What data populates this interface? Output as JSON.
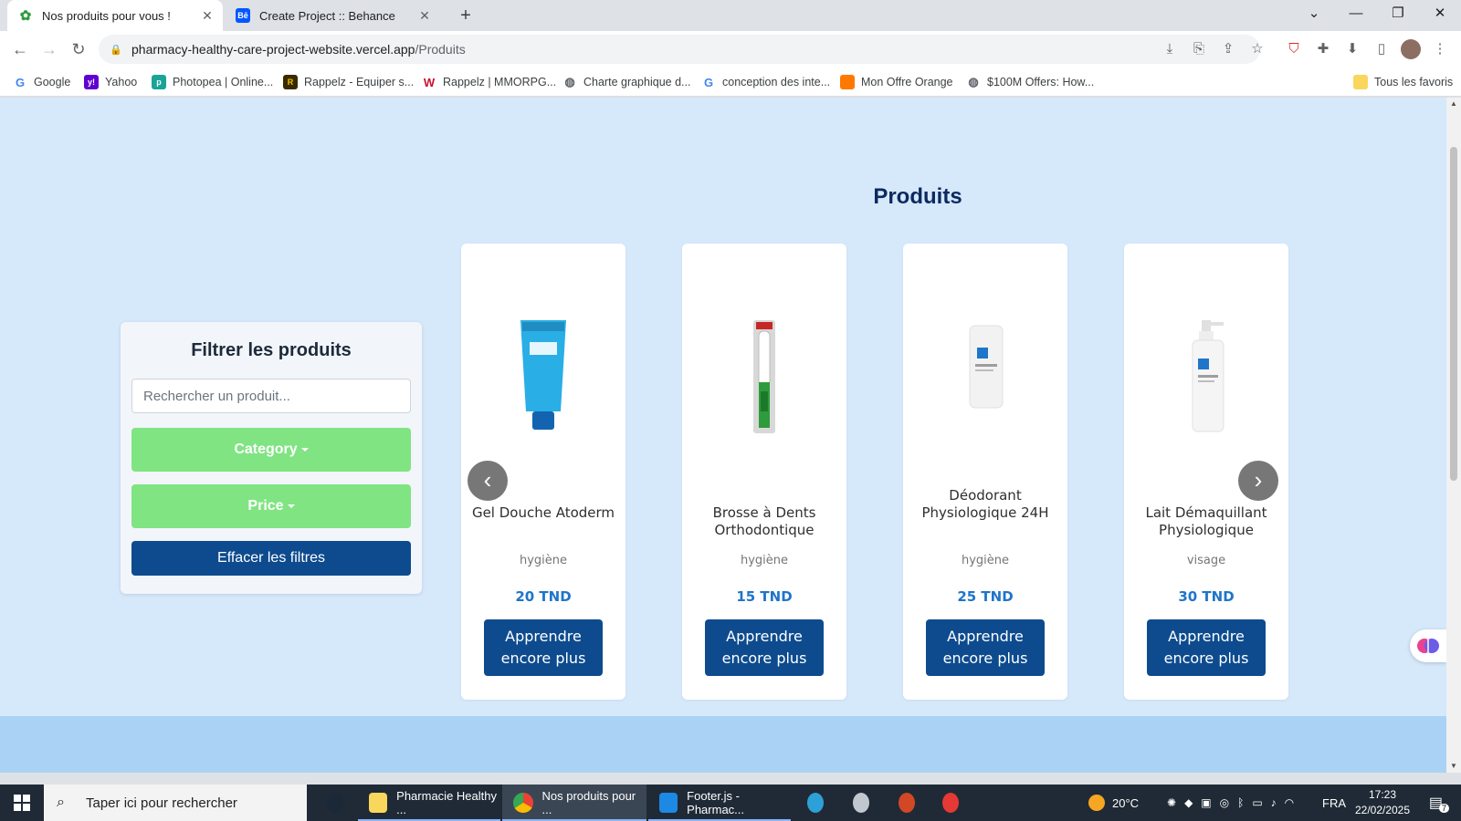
{
  "browser": {
    "tabs": [
      {
        "title": "Nos produits pour vous !",
        "active": true
      },
      {
        "title": "Create Project :: Behance",
        "active": false
      }
    ],
    "url_host": "pharmacy-healthy-care-project-website.vercel.app",
    "url_path": "/Produits",
    "bookmarks": [
      {
        "label": "Google",
        "icon": "google-icon",
        "color": "#4285f4"
      },
      {
        "label": "Yahoo",
        "icon": "yahoo-icon",
        "color": "#6001d2"
      },
      {
        "label": "Photopea | Online...",
        "icon": "photopea-icon",
        "color": "#18a497"
      },
      {
        "label": "Rappelz - Equiper s...",
        "icon": "rappelz-icon",
        "color": "#3a2a00"
      },
      {
        "label": "Rappelz | MMORPG...",
        "icon": "rappelz-w-icon",
        "color": "#c8102e"
      },
      {
        "label": "Charte graphique d...",
        "icon": "globe-icon",
        "color": "#5f6368"
      },
      {
        "label": "conception des inte...",
        "icon": "google-icon",
        "color": "#4285f4"
      },
      {
        "label": "Mon Offre Orange",
        "icon": "orange-icon",
        "color": "#ff7900"
      },
      {
        "label": "$100M Offers: How...",
        "icon": "globe-icon",
        "color": "#5f6368"
      }
    ],
    "all_bookmarks_label": "Tous les favoris"
  },
  "page": {
    "title": "Produits",
    "filter": {
      "title": "Filtrer les produits",
      "search_placeholder": "Rechercher un produit...",
      "category_label": "Category",
      "price_label": "Price",
      "clear_label": "Effacer les filtres"
    },
    "products": [
      {
        "name": "Gel Douche Atoderm",
        "category": "hygiène",
        "price": "20 TND",
        "button": "Apprendre encore plus"
      },
      {
        "name": "Brosse à Dents Orthodontique",
        "category": "hygiène",
        "price": "15 TND",
        "button": "Apprendre encore plus"
      },
      {
        "name": "Déodorant Physiologique 24H",
        "category": "hygiène",
        "price": "25 TND",
        "button": "Apprendre encore plus"
      },
      {
        "name": "Lait Démaquillant Physiologique",
        "category": "visage",
        "price": "30 TND",
        "button": "Apprendre encore plus"
      }
    ]
  },
  "taskbar": {
    "search_placeholder": "Taper ici pour rechercher",
    "apps": [
      {
        "label": "Pharmacie Healthy ...",
        "icon": "folder-icon"
      },
      {
        "label": "Nos produits pour ...",
        "icon": "chrome-icon",
        "active": true
      },
      {
        "label": "Footer.js - Pharmac...",
        "icon": "vscode-icon"
      }
    ],
    "weather": "20°C",
    "language": "FRA",
    "time": "17:23",
    "date": "22/02/2025",
    "notification_count": "7"
  },
  "colors": {
    "page_bg": "#d6e9fb",
    "title": "#0d2a5e",
    "green_button": "#80e482",
    "dark_blue_button": "#0d4b8e",
    "price_blue": "#1f75c9"
  }
}
